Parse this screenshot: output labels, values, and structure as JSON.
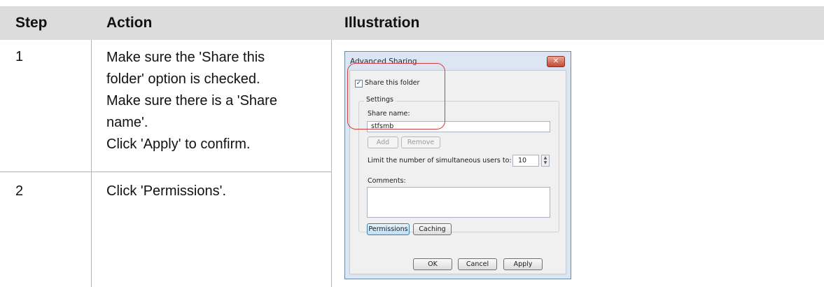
{
  "table": {
    "headers": {
      "step": "Step",
      "action": "Action",
      "illustration": "Illustration"
    },
    "rows": [
      {
        "step": "1",
        "action_lines": [
          "Make sure the 'Share this",
          "folder' option is checked.",
          "Make sure there is a 'Share",
          "name'.",
          "Click 'Apply' to confirm."
        ]
      },
      {
        "step": "2",
        "action_lines": [
          "Click 'Permissions'."
        ]
      }
    ]
  },
  "dialog": {
    "title": "Advanced Sharing",
    "close_icon": "close-icon",
    "share_checkbox_label": "Share this folder",
    "share_checked": true,
    "settings_label": "Settings",
    "share_name_label": "Share name:",
    "share_name_value": "stfsmb",
    "add_label": "Add",
    "remove_label": "Remove",
    "limit_label": "Limit the number of simultaneous users to:",
    "limit_value": "10",
    "comments_label": "Comments:",
    "comments_value": "",
    "permissions_label": "Permissions",
    "caching_label": "Caching",
    "ok_label": "OK",
    "cancel_label": "Cancel",
    "apply_label": "Apply",
    "highlight_color": "#d63d3d"
  }
}
